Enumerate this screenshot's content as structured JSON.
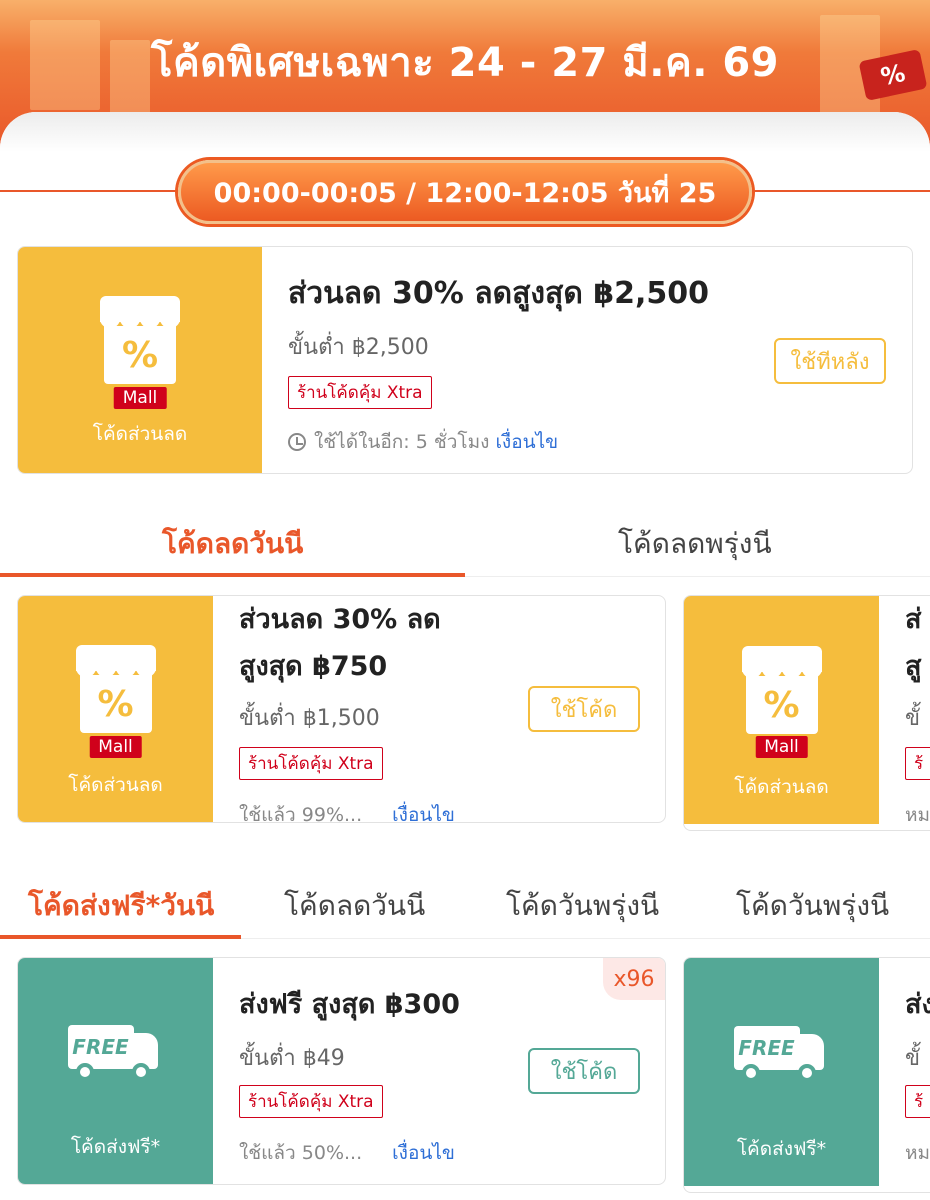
{
  "banner": {
    "title": "โค้ดพิเศษเฉพาะ 24 - 27 มี.ค. 69",
    "tag": "%"
  },
  "time_slot": "00:00-00:05 / 12:00-12:05 วันที่ 25",
  "featured_voucher": {
    "badge": "Mall",
    "caption": "โค้ดส่วนลด",
    "icon_symbol": "%",
    "title": "ส่วนลด 30% ลดสูงสุด ฿2,500",
    "min_spend": "ขั้นต่ำ ฿2,500",
    "tag": "ร้านโค้ดคุ้ม Xtra",
    "countdown": "ใช้ได้ในอีก: 5 ชั่วโมง",
    "conditions_link": "เงื่อนไข",
    "button": "ใช้ทีหลัง"
  },
  "discount_tabs": [
    "โค้ดลดวันนี",
    "โค้ดลดพรุ่งนี"
  ],
  "discount_vouchers": [
    {
      "badge": "Mall",
      "caption": "โค้ดส่วนลด",
      "icon_symbol": "%",
      "title_line1": "ส่วนลด 30% ลด",
      "title_line2": "สูงสุด ฿750",
      "min_spend": "ขั้นต่ำ ฿1,500",
      "tag": "ร้านโค้ดคุ้ม Xtra",
      "usage": "ใช้แล้ว 99%...",
      "conditions_link": "เงื่อนไข",
      "button": "ใช้โค้ด"
    },
    {
      "badge": "Mall",
      "caption": "โค้ดส่วนลด",
      "icon_symbol": "%",
      "title_line1": "ส่",
      "title_line2": "สู",
      "min_spend": "ขั้",
      "tag": "ร้",
      "usage": "หม"
    }
  ],
  "shipping_tabs": [
    "โค้ดส่งฟรี*วันนี",
    "โค้ดลดวันนี",
    "โค้ดวันพรุ่งนี",
    "โค้ดวันพรุ่งนี"
  ],
  "shipping_vouchers": [
    {
      "icon_text": "FREE",
      "caption": "โค้ดส่งฟรี*",
      "title": "ส่งฟรี สูงสุด ฿300",
      "min_spend": "ขั้นต่ำ ฿49",
      "tag": "ร้านโค้ดคุ้ม Xtra",
      "usage": "ใช้แล้ว 50%...",
      "conditions_link": "เงื่อนไข",
      "button": "ใช้โค้ด",
      "quantity": "x96"
    },
    {
      "icon_text": "FREE",
      "caption": "โค้ดส่งฟรี*",
      "title": "ส่ง",
      "min_spend": "ขั้",
      "tag": "ร้",
      "usage": "หม"
    }
  ],
  "colors": {
    "accent": "#e9572a",
    "discount": "#f5bd3d",
    "shipping": "#54a896",
    "mall": "#d0011b",
    "link": "#2f6fd6"
  }
}
